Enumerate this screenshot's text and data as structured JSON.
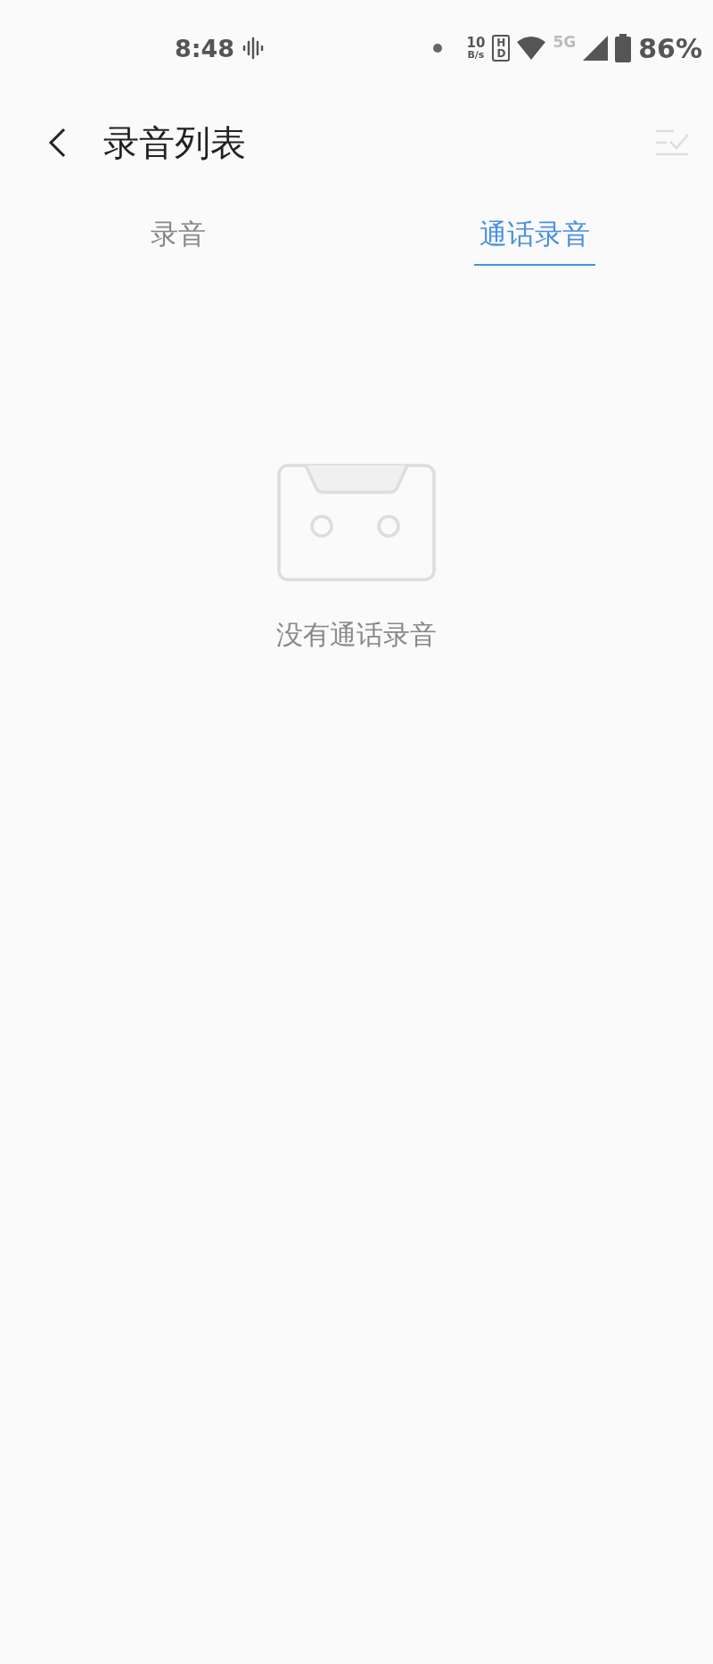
{
  "status_bar": {
    "time": "8:48",
    "net_speed_value": "10",
    "net_speed_unit": "B/s",
    "hd_badge": "HD",
    "network_type": "5G",
    "battery": "86%"
  },
  "header": {
    "title": "录音列表"
  },
  "tabs": [
    {
      "label": "录音",
      "selected": false
    },
    {
      "label": "通话录音",
      "selected": true
    }
  ],
  "empty_state": {
    "message": "没有通话录音"
  }
}
